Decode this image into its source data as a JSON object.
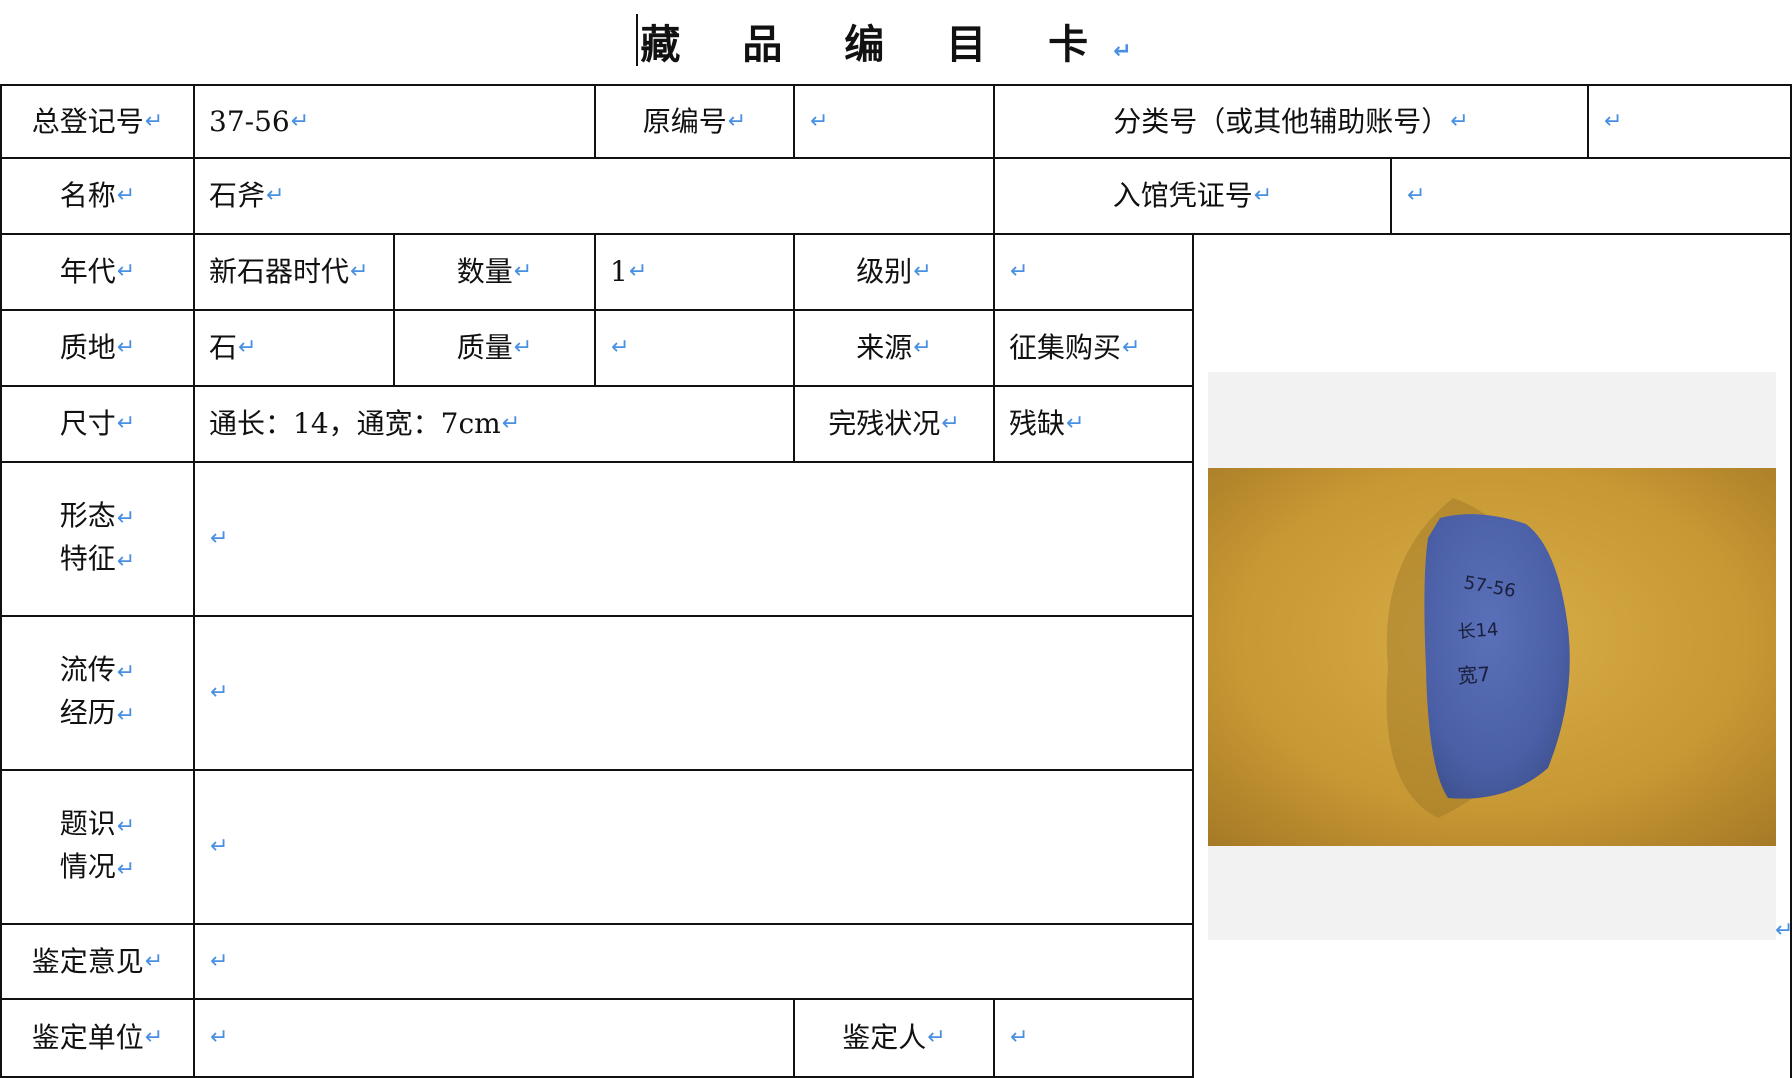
{
  "title": "藏 品 编 目 卡",
  "pilcrow": "↵",
  "fields": {
    "register_no_label": "总登记号",
    "register_no_value": "37-56",
    "orig_no_label": "原编号",
    "orig_no_value": "",
    "class_no_label": "分类号（或其他辅助账号）",
    "class_no_value": "",
    "name_label": "名称",
    "name_value": "石斧",
    "entry_voucher_label": "入馆凭证号",
    "entry_voucher_value": "",
    "era_label": "年代",
    "era_value": "新石器时代",
    "quantity_label": "数量",
    "quantity_value": "1",
    "grade_label": "级别",
    "grade_value": "",
    "material_label": "质地",
    "material_value": "石",
    "weight_label": "质量",
    "weight_value": "",
    "source_label": "来源",
    "source_value": "征集购买",
    "size_label": "尺寸",
    "size_value": "通长：14，通宽：7cm",
    "condition_label": "完残状况",
    "condition_value": "残缺",
    "form_label_1": "形态",
    "form_label_2": "特征",
    "form_value": "",
    "history_label_1": "流传",
    "history_label_2": "经历",
    "history_value": "",
    "inscription_label_1": "题识",
    "inscription_label_2": "情况",
    "inscription_value": "",
    "opinion_label": "鉴定意见",
    "opinion_value": "",
    "unit_label": "鉴定单位",
    "unit_value": "",
    "appraiser_label": "鉴定人",
    "appraiser_value": ""
  },
  "photo": {
    "handwriting_1": "57-56",
    "handwriting_2": "长14",
    "handwriting_3": "宽7",
    "colors": {
      "stone": "#4a5fa6",
      "background": "#c99a36"
    }
  }
}
